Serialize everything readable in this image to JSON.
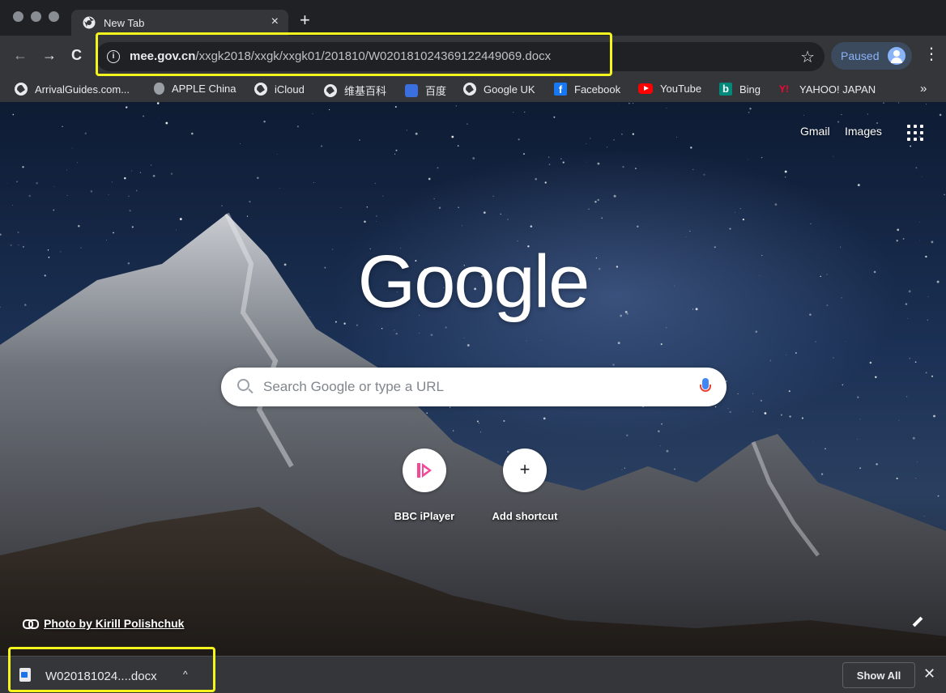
{
  "window": {
    "tab": {
      "title": "New Tab",
      "close_glyph": "×"
    },
    "new_tab_glyph": "+"
  },
  "toolbar": {
    "back_glyph": "←",
    "forward_glyph": "→",
    "reload_glyph": "C",
    "url_domain": "mee.gov.cn",
    "url_path": "/xxgk2018/xxgk/xxgk01/201810/W020181024369122449069.docx",
    "info_glyph": "i",
    "star_glyph": "☆",
    "profile_label": "Paused",
    "menu_glyph": "⋮"
  },
  "bookmarks": [
    {
      "label": "ArrivalGuides.com...",
      "icon": "globe-icon"
    },
    {
      "label": "APPLE China",
      "icon": "apple-icon"
    },
    {
      "label": "iCloud",
      "icon": "globe-icon"
    },
    {
      "label": "维基百科",
      "icon": "globe-icon"
    },
    {
      "label": "百度",
      "icon": "baidu-icon"
    },
    {
      "label": "Google UK",
      "icon": "globe-icon"
    },
    {
      "label": "Facebook",
      "icon": "facebook-icon"
    },
    {
      "label": "YouTube",
      "icon": "youtube-icon"
    },
    {
      "label": "Bing",
      "icon": "bing-icon"
    },
    {
      "label": "YAHOO! JAPAN",
      "icon": "yahoo-icon"
    }
  ],
  "bookmarks_more": "»",
  "ntp": {
    "gmail": "Gmail",
    "images": "Images",
    "logo": "Google",
    "search_placeholder": "Search Google or type a URL",
    "shortcuts": [
      {
        "label": "BBC iPlayer",
        "icon": "bbc-iplayer-icon"
      },
      {
        "label": "Add shortcut",
        "icon": "plus-icon",
        "glyph": "+"
      }
    ],
    "photo_credit": "Photo by Kirill Polishchuk"
  },
  "download_shelf": {
    "file_name": "W020181024....docx",
    "caret_glyph": "^",
    "show_all": "Show All",
    "close_glyph": "✕"
  },
  "colors": {
    "highlight": "#f5f51e",
    "frame": "#35363a",
    "accent": "#8ab4f8"
  }
}
